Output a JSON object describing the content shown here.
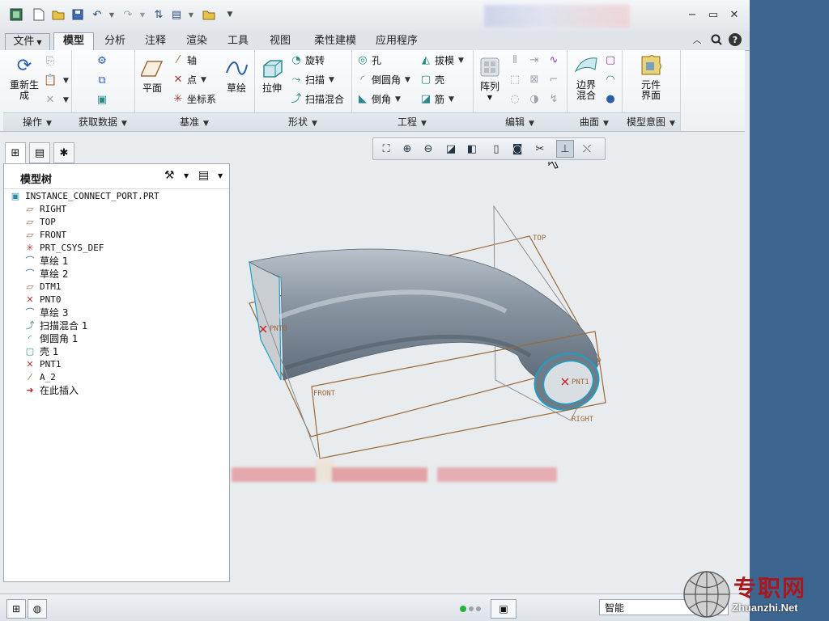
{
  "app": {
    "tabs": [
      {
        "label": "文件"
      },
      {
        "label": "模型"
      },
      {
        "label": "分析"
      },
      {
        "label": "注释"
      },
      {
        "label": "渲染"
      },
      {
        "label": "工具"
      },
      {
        "label": "视图"
      },
      {
        "label": "柔性建模"
      },
      {
        "label": "应用程序"
      }
    ]
  },
  "ribbon": {
    "ops": {
      "regen": "重新生成",
      "label": "操作"
    },
    "getdata": {
      "label": "获取数据"
    },
    "datum": {
      "plane": "平面",
      "axis": "轴",
      "point": "点",
      "csys": "坐标系",
      "sketch": "草绘",
      "label": "基准"
    },
    "shapes": {
      "extrude": "拉伸",
      "revolve": "旋转",
      "sweep": "扫描",
      "swept_blend": "扫描混合",
      "label": "形状"
    },
    "eng": {
      "hole": "孔",
      "draft": "拔模",
      "round": "倒圆角",
      "shell": "壳",
      "chamfer": "倒角",
      "rib": "筋",
      "label": "工程"
    },
    "edit": {
      "pattern": "阵列",
      "label": "编辑"
    },
    "surfaces": {
      "boundary_blend": "边界混合",
      "label": "曲面"
    },
    "intent": {
      "component_interface": "元件界面",
      "label": "模型意图"
    }
  },
  "tree": {
    "title": "模型树",
    "items": [
      {
        "label": "INSTANCE_CONNECT_PORT.PRT",
        "icon": "part-icon"
      },
      {
        "label": "RIGHT",
        "icon": "datum-plane-icon"
      },
      {
        "label": "TOP",
        "icon": "datum-plane-icon"
      },
      {
        "label": "FRONT",
        "icon": "datum-plane-icon"
      },
      {
        "label": "PRT_CSYS_DEF",
        "icon": "csys-icon"
      },
      {
        "label": "草绘 1",
        "icon": "sketch-icon"
      },
      {
        "label": "草绘 2",
        "icon": "sketch-icon"
      },
      {
        "label": "DTM1",
        "icon": "datum-plane-icon"
      },
      {
        "label": "PNT0",
        "icon": "datum-point-icon"
      },
      {
        "label": "草绘 3",
        "icon": "sketch-icon"
      },
      {
        "label": "扫描混合 1",
        "icon": "swept-blend-icon"
      },
      {
        "label": "倒圆角 1",
        "icon": "round-icon"
      },
      {
        "label": "壳 1",
        "icon": "shell-icon"
      },
      {
        "label": "PNT1",
        "icon": "datum-point-icon"
      },
      {
        "label": "A_2",
        "icon": "datum-axis-icon"
      },
      {
        "label": "在此插入",
        "icon": "insert-here-arrow-icon"
      }
    ]
  },
  "viewport": {
    "labels": {
      "top": "TOP",
      "front": "FRONT",
      "right": "RIGHT",
      "pnt0": "PNT0",
      "pnt1": "PNT1"
    }
  },
  "status": {
    "filter": "智能"
  },
  "watermark": {
    "text": "专职网",
    "url": "Zhuanzhi.Net"
  },
  "colors": {
    "datum_plane": "#9b6a3a",
    "part_surface": "#7d8a96",
    "edge_highlight": "#1aa0c8",
    "background": "#e9ecef"
  }
}
